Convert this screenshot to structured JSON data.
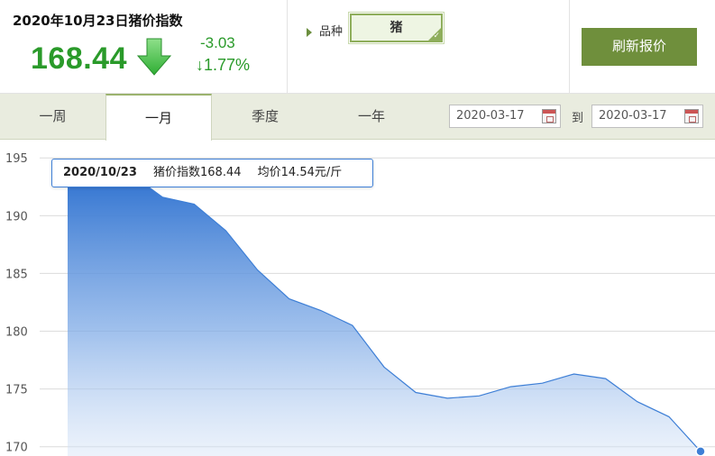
{
  "header": {
    "date_title": "2020年10月23日猪价指数",
    "index_value": "168.44",
    "change_abs": "-3.03",
    "change_pct": "↓1.77%",
    "trend_icon": "down-arrow-icon",
    "trend_color": "#2a9a2a"
  },
  "variety": {
    "label": "品种",
    "selected": "猪"
  },
  "refresh": {
    "label": "刷新报价",
    "color": "#6f8f3c"
  },
  "tabs": [
    {
      "label": "一周",
      "active": false
    },
    {
      "label": "一月",
      "active": true
    },
    {
      "label": "季度",
      "active": false
    },
    {
      "label": "一年",
      "active": false
    }
  ],
  "range": {
    "start": "2020-03-17",
    "to_label": "到",
    "end": "2020-03-17"
  },
  "tooltip": {
    "date": "2020/10/23",
    "index_text": "猪价指数168.44",
    "avg_text": "均价14.54元/斤"
  },
  "chart_data": {
    "type": "area",
    "title": "",
    "xlabel": "",
    "ylabel": "",
    "y_ticks": [
      "195",
      "190",
      "185",
      "180",
      "175",
      "170"
    ],
    "ylim": [
      169.2,
      196.5
    ],
    "grid": true,
    "accent_color": "#3e7fd6",
    "series": [
      {
        "values": [
          193.6,
          193.6,
          193.6,
          191.6,
          191.0,
          188.7,
          185.3,
          182.8,
          181.8,
          180.5,
          176.9,
          174.7,
          174.2,
          174.4,
          175.2,
          175.5,
          176.3,
          175.9,
          173.9,
          172.6,
          169.6
        ]
      }
    ]
  }
}
